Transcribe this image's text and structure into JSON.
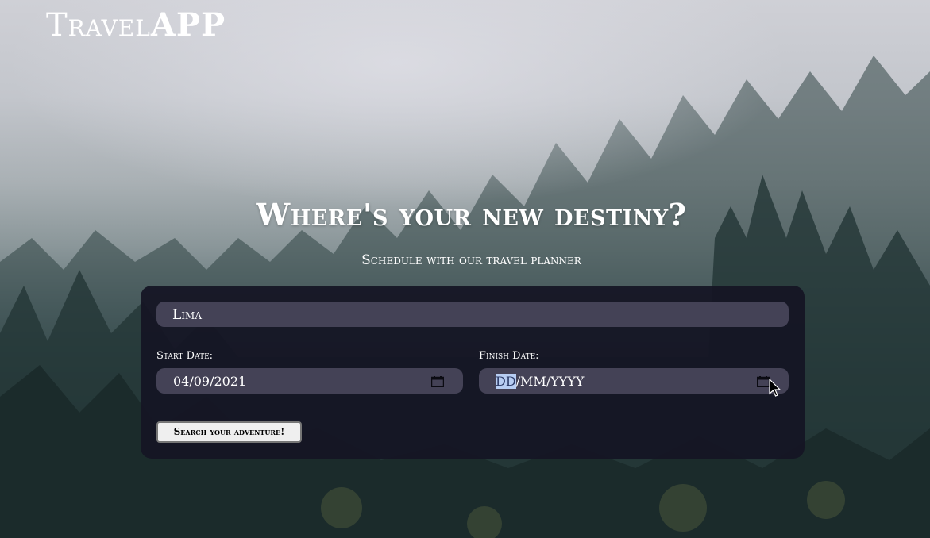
{
  "brand": {
    "light": "Travel",
    "bold": "APP"
  },
  "hero": {
    "title": "Where's your new destiny?",
    "subtitle": "Schedule with our travel planner"
  },
  "form": {
    "destination_value": "Lima",
    "start_label": "Start Date:",
    "start_value": "04/09/2021",
    "finish_label": "Finish Date:",
    "finish_value_day": "DD",
    "finish_value_rest": "/MM/YYYY",
    "search_label": "Search your adventure!"
  },
  "icons": {
    "calendar": "calendar-icon",
    "cursor": "mouse-pointer-icon"
  },
  "colors": {
    "panel": "#14141f",
    "field": "#444256",
    "text": "#ffffff",
    "selection": "#b7cdf2"
  }
}
